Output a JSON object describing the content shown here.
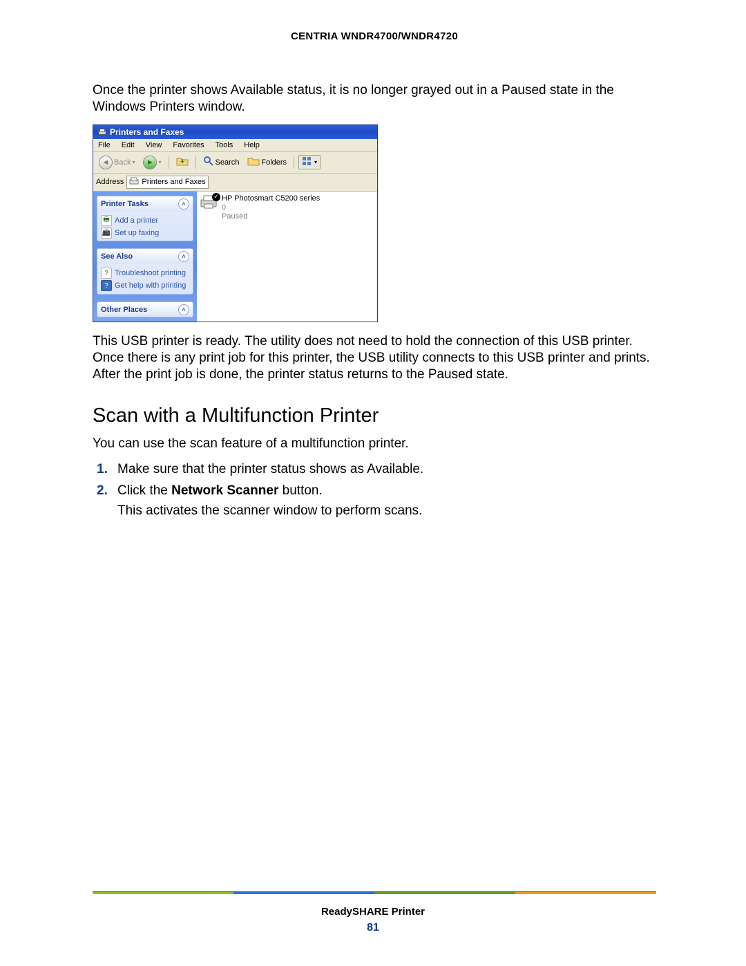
{
  "header": {
    "title": "CENTRIA WNDR4700/WNDR4720"
  },
  "para1": "Once the printer shows Available status, it is no longer grayed out in a Paused state in the Windows Printers window.",
  "xp": {
    "title": "Printers and Faxes",
    "menu": {
      "file": "File",
      "edit": "Edit",
      "view": "View",
      "favorites": "Favorites",
      "tools": "Tools",
      "help": "Help"
    },
    "toolbar": {
      "back": "Back",
      "search": "Search",
      "folders": "Folders"
    },
    "address": {
      "label": "Address",
      "value": "Printers and Faxes"
    },
    "side": {
      "tasks_head": "Printer Tasks",
      "add_printer": "Add a printer",
      "set_faxing": "Set up faxing",
      "seealso_head": "See Also",
      "troubleshoot": "Troubleshoot printing",
      "gethelp": "Get help with printing",
      "other_head": "Other Places"
    },
    "printer": {
      "name": "HP Photosmart C5200 series",
      "queue": "0",
      "status": "Paused"
    }
  },
  "para2": "This USB printer is ready. The utility does not need to hold the connection of this USB printer. Once there is any print job for this printer, the USB utility connects to this USB printer and prints. After the print job is done, the printer status returns to the Paused state.",
  "section_heading": "Scan with a Multifunction Printer",
  "para3": "You can use the scan feature of a multifunction printer.",
  "steps": {
    "s1_num": "1.",
    "s1_text": "Make sure that the printer status shows as Available.",
    "s2_num": "2.",
    "s2_pre": "Click the ",
    "s2_bold": "Network Scanner",
    "s2_post": " button.",
    "s2_sub": "This activates the scanner window to perform scans."
  },
  "footer": {
    "title": "ReadySHARE Printer",
    "page": "81"
  }
}
